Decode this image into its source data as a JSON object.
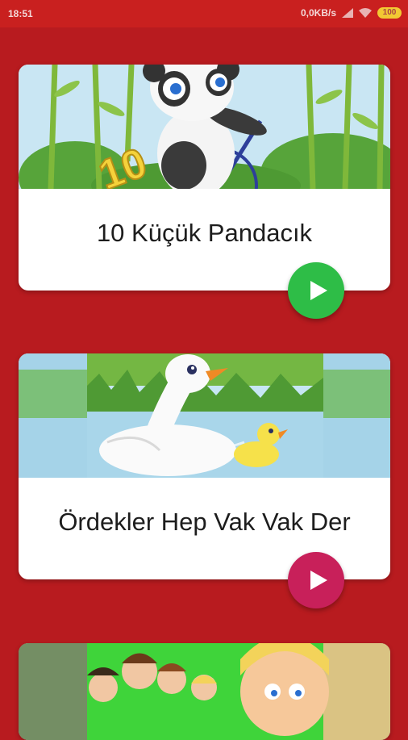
{
  "status_bar": {
    "time": "18:51",
    "network_speed": "0,0KB/s",
    "battery": "100"
  },
  "colors": {
    "background": "#b81b1f",
    "play_first": "#2ebd47",
    "play_second": "#c8205a"
  },
  "songs": [
    {
      "title": "10 Küçük Pandacık",
      "thumbnail": "panda riding a bicycle among bamboo with number 10",
      "play_icon": "play-icon"
    },
    {
      "title": "Ördekler Hep Vak Vak Der",
      "thumbnail": "white duck and yellow duckling on a pond",
      "play_icon": "play-icon"
    },
    {
      "title": "",
      "thumbnail": "cartoon children on green background",
      "play_icon": ""
    }
  ]
}
